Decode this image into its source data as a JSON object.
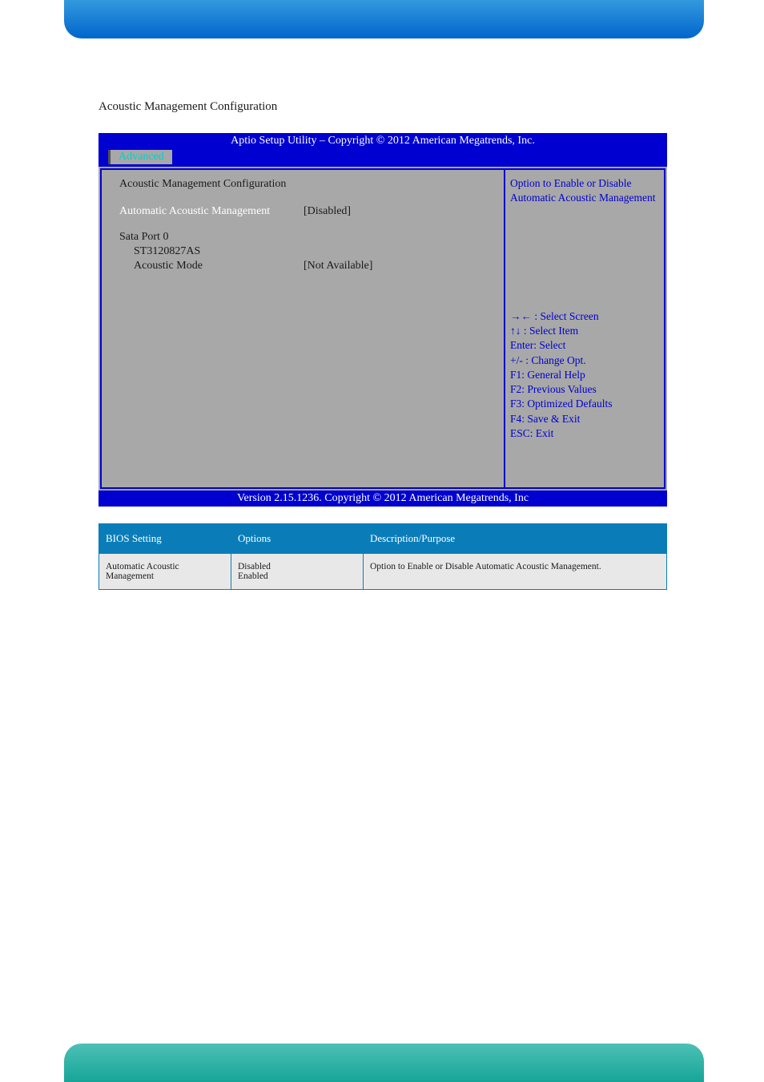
{
  "section_title": "Acoustic Management Configuration",
  "bios": {
    "header": "Aptio Setup Utility  –  Copyright © 2012 American Megatrends, Inc.",
    "tab": "Advanced",
    "main": {
      "heading": "Acoustic Management Configuration",
      "rows": [
        {
          "label": "Automatic Acoustic Management",
          "value": "[Disabled]",
          "selected": true
        },
        {
          "label": "",
          "value": ""
        },
        {
          "label": "Sata Port 0",
          "value": ""
        },
        {
          "label": "ST3120827AS",
          "value": "",
          "indent": true
        },
        {
          "label": "Acoustic Mode",
          "value": "[Not Available]",
          "indent": true
        }
      ]
    },
    "side": {
      "top": "Option to Enable or Disable Automatic Acoustic Management",
      "bottom": [
        "→← : Select Screen",
        "↑↓ : Select Item",
        "Enter: Select",
        "+/- : Change Opt.",
        "F1: General Help",
        "F2: Previous Values",
        "F3: Optimized Defaults",
        "F4: Save & Exit",
        "ESC: Exit"
      ]
    },
    "footer": "Version 2.15.1236. Copyright © 2012 American Megatrends, Inc"
  },
  "info_table": {
    "headers": [
      "BIOS Setting",
      "Options",
      "Description/Purpose"
    ],
    "rows": [
      {
        "setting": "Automatic Acoustic Management",
        "options": "Disabled\nEnabled",
        "desc": "Option to Enable or Disable Automatic Acoustic Management."
      }
    ]
  }
}
